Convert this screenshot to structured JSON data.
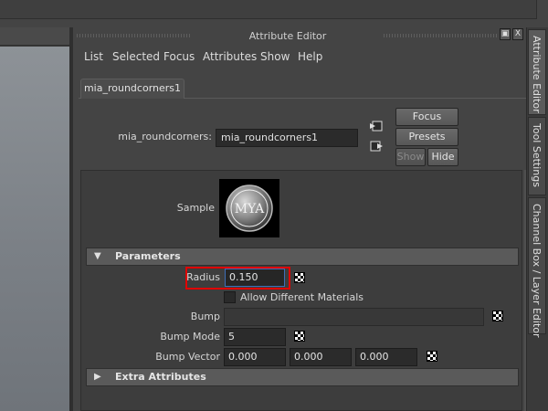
{
  "window": {
    "title": "Attribute Editor",
    "float_button": "▣",
    "close_button": "X"
  },
  "menu": [
    "List",
    "Selected",
    "Focus",
    "Attributes",
    "Show",
    "Help"
  ],
  "tab": {
    "label": "mia_roundcorners1"
  },
  "node": {
    "label": "mia_roundcorners:",
    "value": "mia_roundcorners1"
  },
  "buttons": {
    "focus": "Focus",
    "presets": "Presets",
    "show": "Show",
    "hide": "Hide"
  },
  "sample": {
    "label": "Sample",
    "swatch_text": "MYA"
  },
  "parameters": {
    "title": "Parameters",
    "radius_label": "Radius",
    "radius_value": "0.150",
    "allow_diff_label": "Allow Different Materials",
    "bump_label": "Bump",
    "bump_value": "",
    "bump_mode_label": "Bump Mode",
    "bump_mode_value": "5",
    "bump_vector_label": "Bump Vector",
    "bump_vector": [
      "0.000",
      "0.000",
      "0.000"
    ]
  },
  "extra": {
    "title": "Extra Attributes"
  },
  "side_tabs": [
    "Attribute Editor",
    "Tool Settings",
    "Channel Box / Layer Editor"
  ],
  "colors": {
    "highlight": "#e00000",
    "panel": "#444444"
  }
}
